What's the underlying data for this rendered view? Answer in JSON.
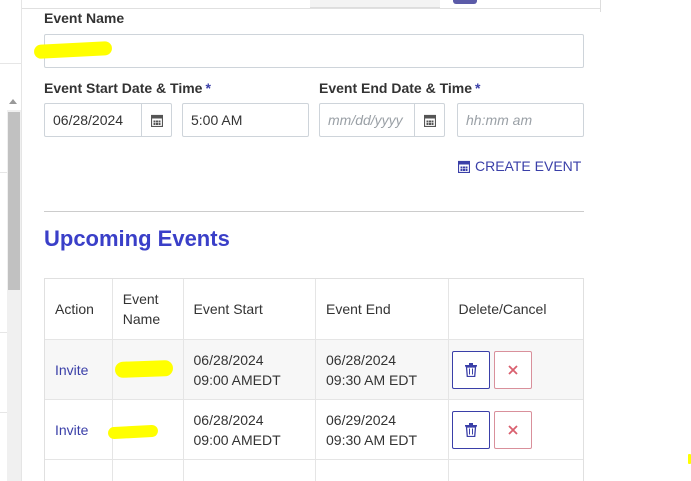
{
  "form": {
    "event_name": {
      "label": "Event Name",
      "value": ""
    },
    "start": {
      "label": "Event Start Date & Time",
      "required_mark": "*",
      "date_value": "06/28/2024",
      "time_value": "5:00 AM"
    },
    "end": {
      "label": "Event End Date & Time",
      "required_mark": "*",
      "date_placeholder": "mm/dd/yyyy",
      "time_placeholder": "hh:mm am"
    },
    "create_label": "CREATE EVENT"
  },
  "upcoming": {
    "title": "Upcoming Events",
    "headers": [
      "Action",
      "Event\nName",
      "Event Start",
      "Event End",
      "Delete/Cancel"
    ],
    "rows": [
      {
        "action": "Invite",
        "name": "",
        "start_date": "06/28/2024",
        "start_time": "09:00 AMEDT",
        "end_date": "06/28/2024",
        "end_time": "09:30 AM EDT"
      },
      {
        "action": "Invite",
        "name": "",
        "start_date": "06/28/2024",
        "start_time": "09:00 AMEDT",
        "end_date": "06/29/2024",
        "end_time": "09:30 AM EDT"
      }
    ]
  },
  "colors": {
    "accent": "#3a3fa8",
    "title": "#3a3fc8",
    "cancel": "#d9606f"
  },
  "icons": {
    "calendar": "calendar-icon",
    "trash": "trash-icon",
    "close": "close-icon"
  }
}
